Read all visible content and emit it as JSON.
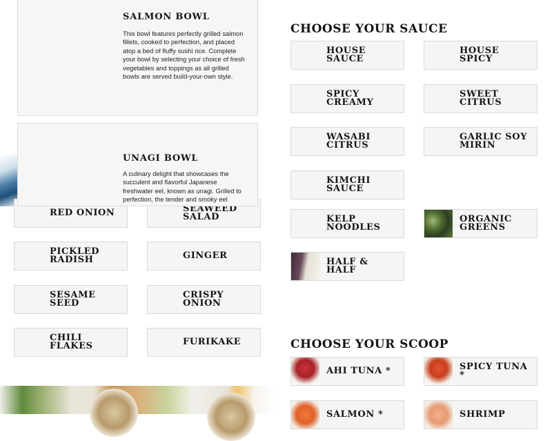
{
  "bowls": [
    {
      "title": "SALMON BOWL",
      "description": "This bowl features perfectly grilled salmon fillets, cooked to perfection, and placed atop a bed of fluffy sushi rice. Complete your bowl by selecting your choice of fresh vegetables and toppings as all grilled bowls are served build-your-own style."
    },
    {
      "title": "UNAGI BOWL",
      "description": "A culinary delight that showcases the succulent and flavorful Japanese freshwater eel, known as unagi. Grilled to perfection, the tender and smoky eel"
    }
  ],
  "toppings": [
    {
      "label": "Red Onion"
    },
    {
      "label": "Seaweed Salad"
    },
    {
      "label": "Pickled Radish"
    },
    {
      "label": "Ginger"
    },
    {
      "label": "Sesame Seed"
    },
    {
      "label": "Crispy Onion"
    },
    {
      "label": "Chili Flakes"
    },
    {
      "label": "Furikake"
    }
  ],
  "sauce": {
    "heading": "Choose Your Sauce",
    "options": [
      {
        "label": "House Sauce"
      },
      {
        "label": "House Spicy"
      },
      {
        "label": "Spicy Creamy"
      },
      {
        "label": "Sweet Citrus"
      },
      {
        "label": "Wasabi Citrus"
      },
      {
        "label": "Garlic Soy Mirin"
      },
      {
        "label": "Kimchi Sauce"
      }
    ]
  },
  "bases": [
    {
      "label": "Kelp Noodles",
      "icon": ""
    },
    {
      "label": "Organic Greens",
      "icon": "greens-photo"
    },
    {
      "label": "Half & Half",
      "icon": "half-and-half-photo"
    }
  ],
  "scoop": {
    "heading": "Choose Your Scoop",
    "options": [
      {
        "label": "Ahi Tuna *",
        "icon": "ahi-tuna-photo"
      },
      {
        "label": "Spicy Tuna *",
        "icon": "spicy-tuna-photo"
      },
      {
        "label": "Salmon *",
        "icon": "salmon-photo"
      },
      {
        "label": "Shrimp",
        "icon": "shrimp-photo"
      }
    ]
  },
  "colors": {
    "card_bg": "#f5f5f5",
    "card_border": "#d9d9d9",
    "text": "#151515"
  }
}
